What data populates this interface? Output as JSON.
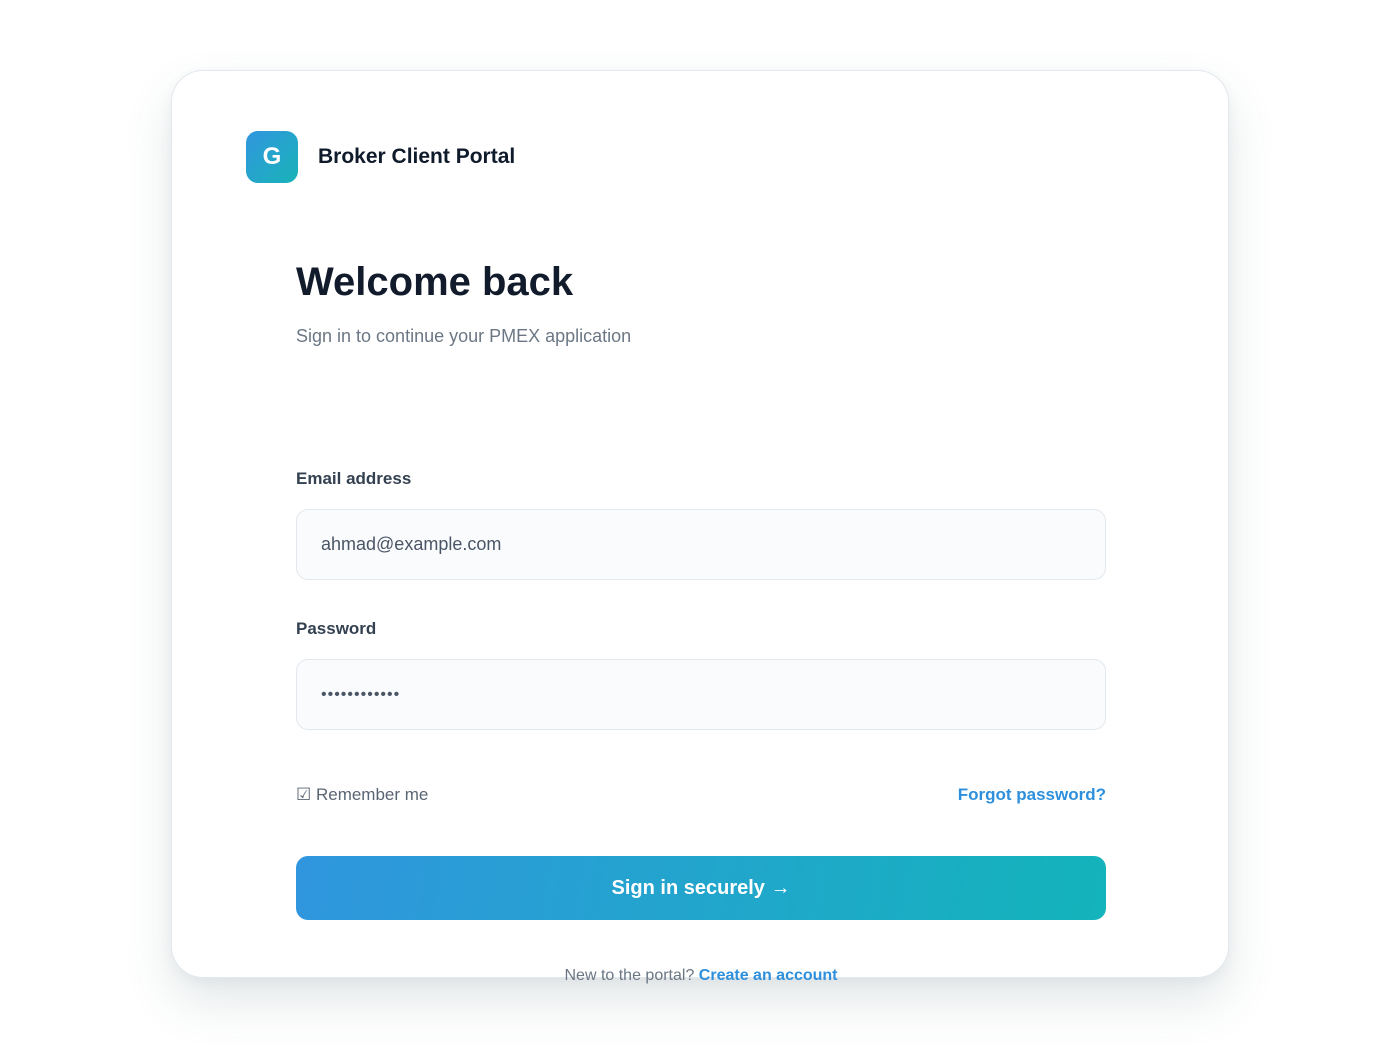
{
  "brand": {
    "logo_letter": "G",
    "name": "Broker Client Portal"
  },
  "heading": {
    "title": "Welcome back",
    "subtitle": "Sign in to continue your PMEX application"
  },
  "form": {
    "email_label": "Email address",
    "email_value": "ahmad@example.com",
    "password_label": "Password",
    "password_value": "••••••••••••",
    "remember_label": "☑ Remember me",
    "forgot_label": "Forgot password?",
    "submit_label": "Sign in securely →"
  },
  "footer": {
    "prompt": "New to the portal?",
    "create_label": "Create an account"
  },
  "colors": {
    "accent": "#2e90dc",
    "gradient_start": "#3096de",
    "gradient_end": "#13b4bb"
  }
}
